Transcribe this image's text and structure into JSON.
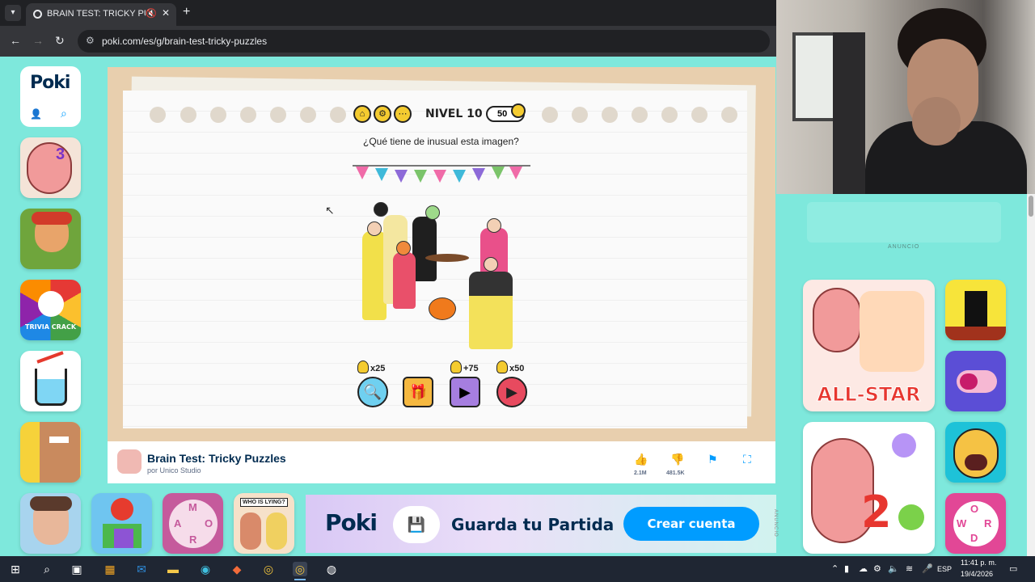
{
  "browser": {
    "tab_title": "BRAIN TEST: TRICKY PUZZL",
    "url": "poki.com/es/g/brain-test-tricky-puzzles",
    "new_tab_symbol": "+",
    "close_symbol": "✕"
  },
  "sidebar": {
    "logo": "Poki",
    "tiles": [
      {
        "name": "brain-test-3"
      },
      {
        "name": "subway-surfers"
      },
      {
        "name": "trivia-crack",
        "label": "TRIVIA CRACK"
      },
      {
        "name": "happy-glass"
      },
      {
        "name": "blocky-game"
      }
    ]
  },
  "game": {
    "level_label": "NIVEL 10",
    "coins": "50",
    "question": "¿Qué tiene de inusual esta imagen?",
    "hints": [
      {
        "label": "x25",
        "icon": "magnifier-icon"
      },
      {
        "label": "",
        "icon": "gift-icon"
      },
      {
        "label": "+75",
        "icon": "video-icon"
      },
      {
        "label": "x50",
        "icon": "skip-icon"
      }
    ]
  },
  "info": {
    "title": "Brain Test: Tricky Puzzles",
    "by": "por Unico Studio",
    "likes": "2.1M",
    "dislikes": "481.5K"
  },
  "right": {
    "ad_label": "ANUNCIO",
    "tiles": [
      {
        "name": "brain-test-all-star",
        "label": "ALL-STAR"
      },
      {
        "name": "pixel-game"
      },
      {
        "name": "nail-game"
      },
      {
        "name": "face-game"
      },
      {
        "name": "brain-test-2"
      },
      {
        "name": "word-game"
      }
    ]
  },
  "bottom_games": [
    {
      "name": "scary-teacher"
    },
    {
      "name": "apple-blocks"
    },
    {
      "name": "word-connect"
    },
    {
      "name": "who-is-lying",
      "label": "WHO IS LYING?"
    }
  ],
  "banner": {
    "logo": "Poki",
    "text": "Guarda tu Partida",
    "cta": "Crear cuenta",
    "ad_label": "ANUNCIO"
  },
  "taskbar": {
    "lang": "ESP",
    "time": "11:41 p. m.",
    "date": "19/4/2026"
  },
  "colors": {
    "accent": "#009cff",
    "background": "#7ee8dc",
    "brand_dark": "#002b50"
  }
}
